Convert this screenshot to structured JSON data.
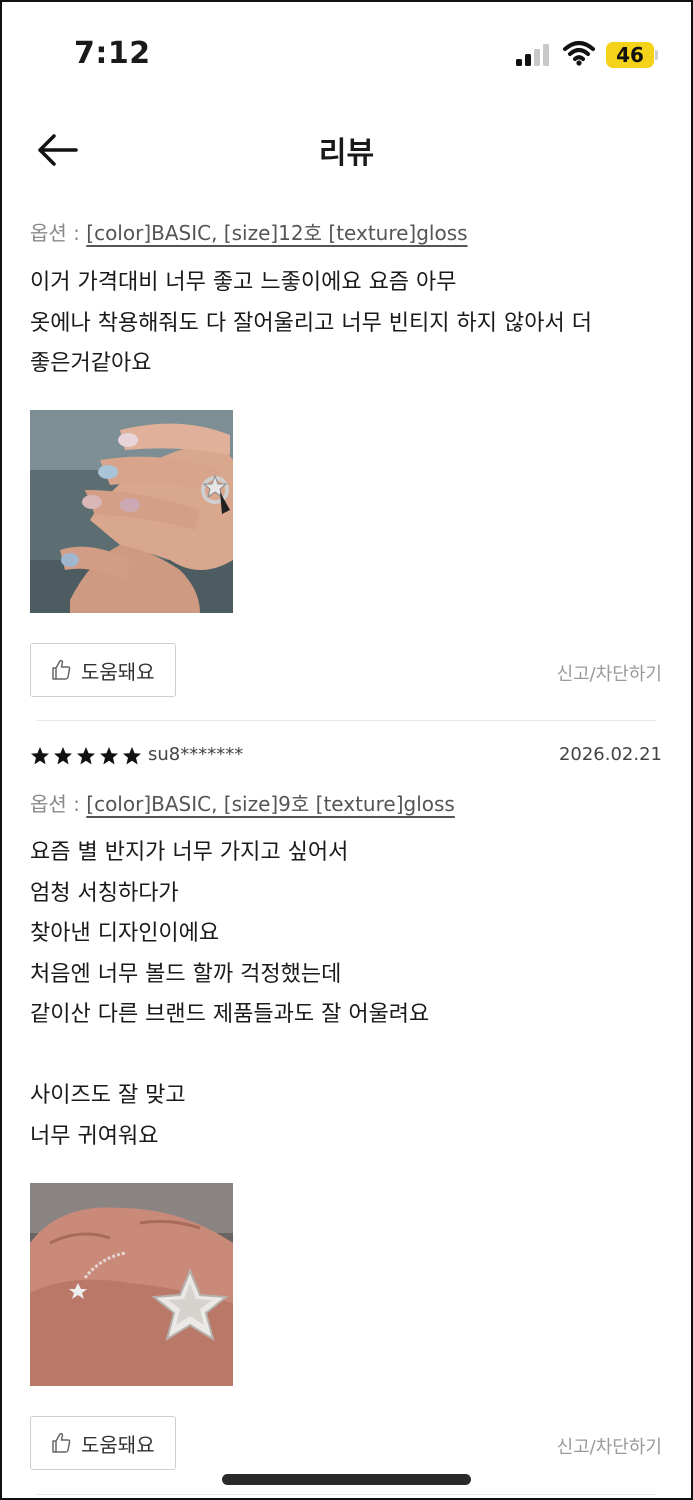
{
  "status_bar": {
    "time": "7:12",
    "battery": "46",
    "battery_color": "#f4d21a"
  },
  "nav": {
    "title": "리뷰",
    "back_icon": "arrow-left-icon"
  },
  "reviews": [
    {
      "option_label": "옵션 :",
      "option_value": "[color]BASIC, [size]12호 [texture]gloss",
      "text": "이거 가격대비 너무 좋고 느좋이에요 요즘 아무\n옷에나 착용해줘도 다 잘어울리고 너무 빈티지 하지 않아서 더\n좋은거같아요",
      "photo_description_icon": "hand-with-star-ring-photo",
      "helpful_label": "도움돼요",
      "report_label": "신고/차단하기"
    },
    {
      "rating": 5,
      "reviewer": "su8*******",
      "date": "2026.02.21",
      "option_label": "옵션 :",
      "option_value": "[color]BASIC, [size]9호 [texture]gloss",
      "text": "요즘 별 반지가 너무 가지고 싶어서\n엄청 서칭하다가\n찾아낸 디자인이에요\n처음엔 너무 볼드 할까 걱정했는데\n같이산 다른 브랜드 제품들과도 잘 어울려요\n\n사이즈도 잘 맞고\n너무 귀여워요",
      "photo_description_icon": "hand-with-star-ring-photo",
      "helpful_label": "도움돼요",
      "report_label": "신고/차단하기"
    }
  ]
}
